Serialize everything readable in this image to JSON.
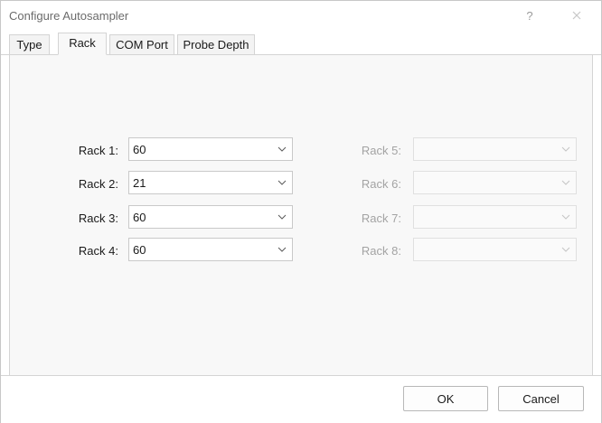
{
  "window": {
    "title": "Configure Autosampler",
    "help_label": "?"
  },
  "tabs": [
    {
      "label": "Type",
      "active": false
    },
    {
      "label": "Rack",
      "active": true
    },
    {
      "label": "COM Port",
      "active": false
    },
    {
      "label": "Probe Depth",
      "active": false
    }
  ],
  "racks_left": [
    {
      "label": "Rack 1:",
      "value": "60",
      "enabled": true
    },
    {
      "label": "Rack 2:",
      "value": "21",
      "enabled": true
    },
    {
      "label": "Rack 3:",
      "value": "60",
      "enabled": true
    },
    {
      "label": "Rack 4:",
      "value": "60",
      "enabled": true
    }
  ],
  "racks_right": [
    {
      "label": "Rack 5:",
      "value": "",
      "enabled": false
    },
    {
      "label": "Rack 6:",
      "value": "",
      "enabled": false
    },
    {
      "label": "Rack 7:",
      "value": "",
      "enabled": false
    },
    {
      "label": "Rack 8:",
      "value": "",
      "enabled": false
    }
  ],
  "footer": {
    "ok_label": "OK",
    "cancel_label": "Cancel"
  },
  "icons": {
    "help": "question-mark-icon",
    "close": "close-icon",
    "dropdown": "chevron-down-icon"
  },
  "colors": {
    "panel_bg": "#f8f8f8",
    "disabled_text": "#a3a3a3",
    "border": "#c9c9c9"
  }
}
